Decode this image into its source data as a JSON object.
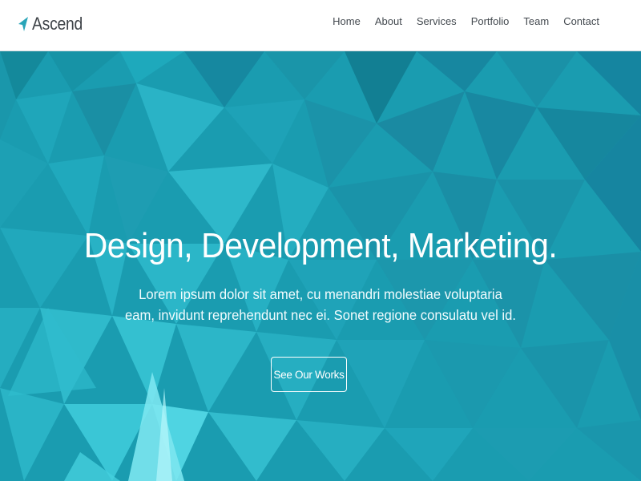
{
  "brand": {
    "name": "Ascend",
    "icon": "paper-plane-icon",
    "accent": "#2aa5b8"
  },
  "nav": {
    "items": [
      {
        "label": "Home"
      },
      {
        "label": "About"
      },
      {
        "label": "Services"
      },
      {
        "label": "Portfolio"
      },
      {
        "label": "Team"
      },
      {
        "label": "Contact"
      }
    ]
  },
  "hero": {
    "title": "Design, Development, Marketing.",
    "subtitle": "Lorem ipsum dolor sit amet, cu menandri molestiae voluptaria eam, invidunt reprehendunt nec ei. Sonet regione consulatu vel id.",
    "cta_label": "See Our Works",
    "background_color": "#1a9fb1"
  }
}
